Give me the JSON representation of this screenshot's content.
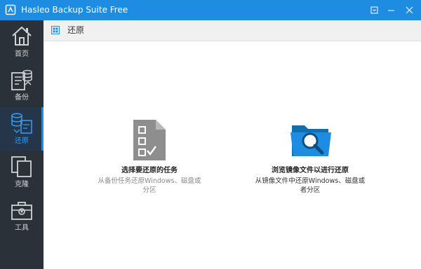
{
  "window": {
    "title": "Hasleo Backup Suite Free",
    "accent_color": "#1e8ce0"
  },
  "sidebar": {
    "items": [
      {
        "label": "首页",
        "icon": "home-icon"
      },
      {
        "label": "备份",
        "icon": "backup-icon"
      },
      {
        "label": "还原",
        "icon": "restore-icon",
        "active": true
      },
      {
        "label": "克隆",
        "icon": "clone-icon"
      },
      {
        "label": "工具",
        "icon": "toolbox-icon"
      }
    ]
  },
  "header": {
    "title": "还原",
    "icon": "grid-icon"
  },
  "cards": {
    "task": {
      "title": "选择要还原的任务",
      "desc": "从备份任务还原Windows、磁盘或分区",
      "icon": "checklist-document-icon"
    },
    "browse": {
      "title": "浏览镜像文件以进行还原",
      "desc": "从镜像文件中还原Windows、磁盘或者分区",
      "icon": "folder-search-icon"
    }
  }
}
